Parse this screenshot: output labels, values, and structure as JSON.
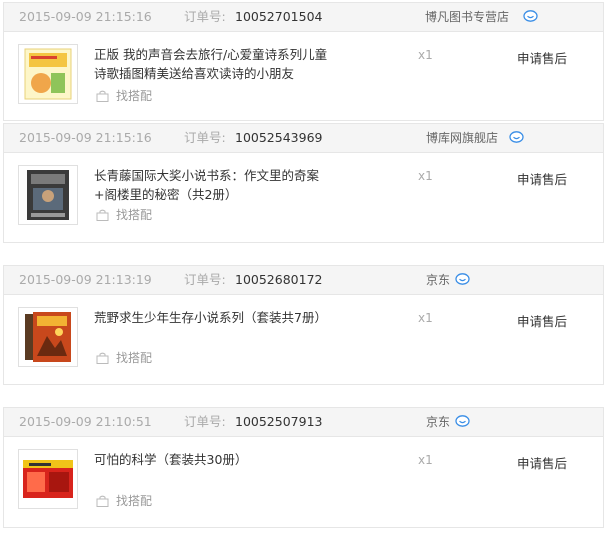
{
  "order_no_label": "订单号:",
  "match_label": "找搭配",
  "after_sale_label": "申请售后",
  "orders": [
    {
      "time": "2015-09-09 21:15:16",
      "order_no": "10052701504",
      "shop": "博凡图书专营店",
      "product_title": "正版 我的声音会去旅行/心爱童诗系列儿童诗歌插图精美送给喜欢读诗的小朋友",
      "qty": "x1"
    },
    {
      "time": "2015-09-09 21:15:16",
      "order_no": "10052543969",
      "shop": "博库网旗舰店",
      "product_title": "长青藤国际大奖小说书系：作文里的奇案+阁楼里的秘密（共2册）",
      "qty": "x1"
    },
    {
      "time": "2015-09-09 21:13:19",
      "order_no": "10052680172",
      "shop": "京东",
      "product_title": "荒野求生少年生存小说系列（套装共7册）",
      "qty": "x1"
    },
    {
      "time": "2015-09-09 21:10:51",
      "order_no": "10052507913",
      "shop": "京东",
      "product_title": "可怕的科学（套装共30册）",
      "qty": "x1"
    }
  ]
}
